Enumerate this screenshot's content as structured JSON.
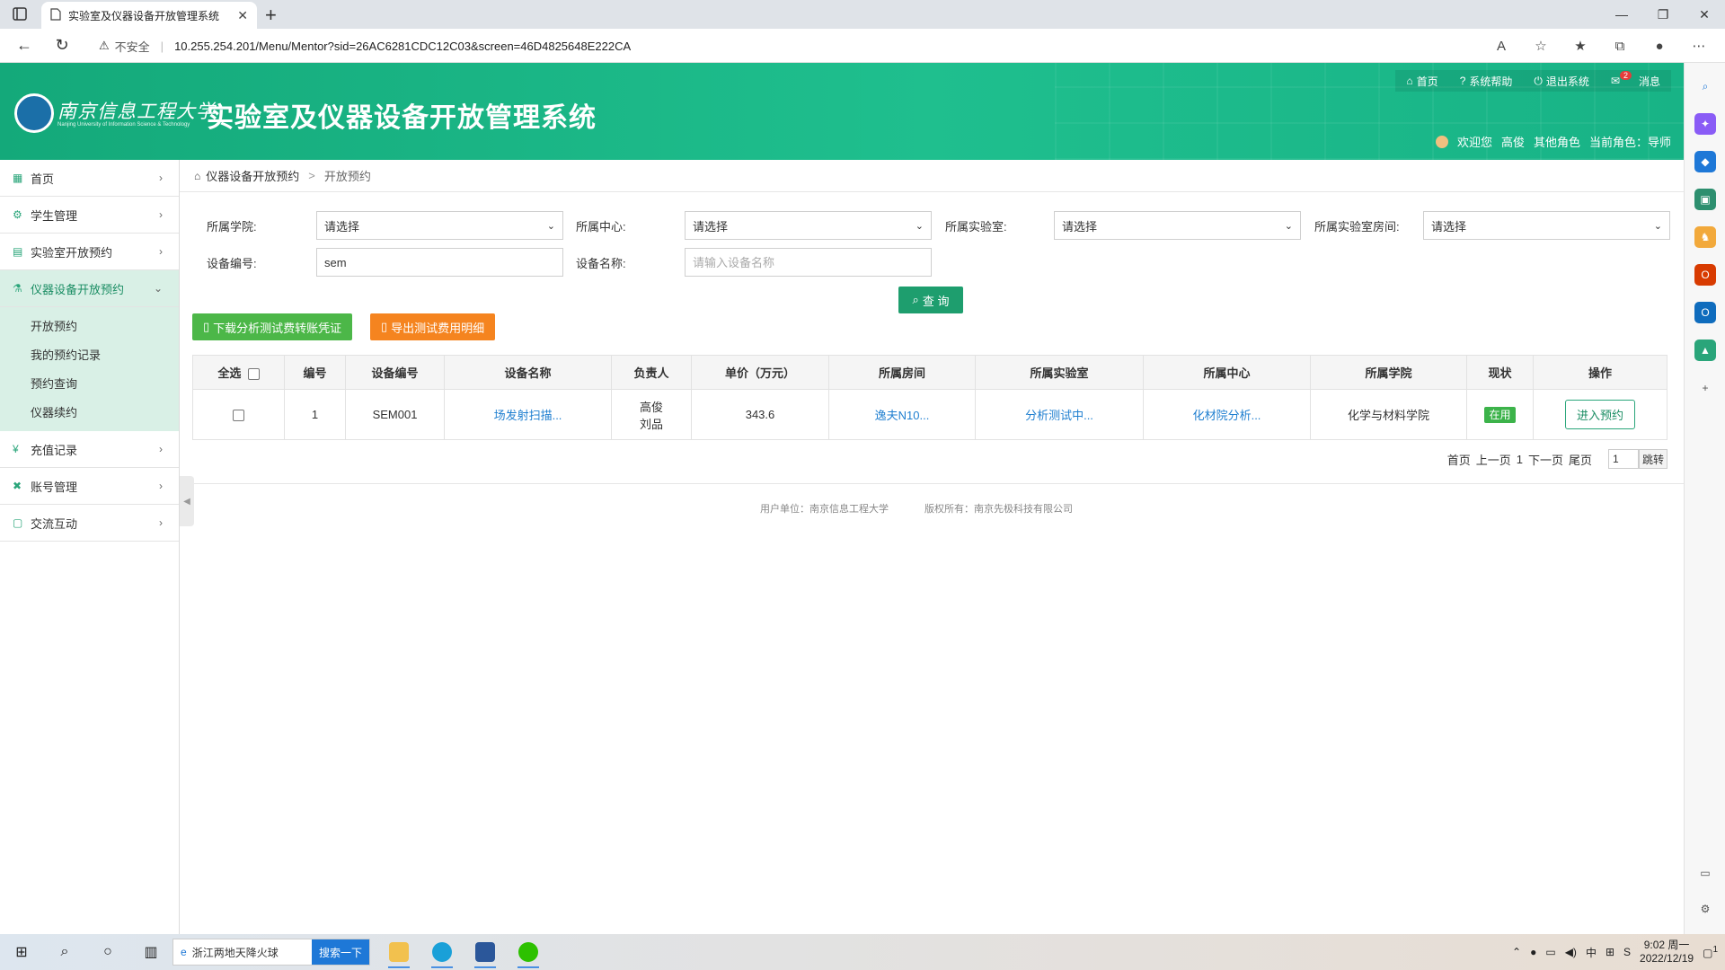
{
  "browser": {
    "tab_title": "实验室及仪器设备开放管理系统",
    "tab_close": "✕",
    "new_tab": "+",
    "insecure_label": "不安全",
    "url": "10.255.254.201/Menu/Mentor?sid=26AC6281CDC12C03&screen=46D4825648E222CA"
  },
  "header": {
    "university_name": "南京信息工程大学",
    "university_name_en": "Nanjing University of Information Science & Technology",
    "system_title": "实验室及仪器设备开放管理系统",
    "top_links": {
      "home": "首页",
      "help": "系统帮助",
      "logout": "退出系统",
      "messages": "消息",
      "messages_badge": "2"
    },
    "user": {
      "welcome": "欢迎您",
      "name": "高俊",
      "other_role": "其他角色",
      "current_role": "当前角色：导师"
    }
  },
  "sidebar": {
    "items": [
      {
        "label": "首页",
        "icon": "table-icon"
      },
      {
        "label": "学生管理",
        "icon": "gear-icon"
      },
      {
        "label": "实验室开放预约",
        "icon": "doc-icon"
      },
      {
        "label": "仪器设备开放预约",
        "icon": "flask-icon"
      },
      {
        "label": "充值记录",
        "icon": "coin-icon"
      },
      {
        "label": "账号管理",
        "icon": "tools-icon"
      },
      {
        "label": "交流互动",
        "icon": "chat-icon"
      }
    ],
    "sub_items": [
      "开放预约",
      "我的预约记录",
      "预约查询",
      "仪器续约"
    ]
  },
  "breadcrumb": {
    "parent": "仪器设备开放预约",
    "separator": ">",
    "current": "开放预约"
  },
  "filters": {
    "college_label": "所属学院:",
    "college_value": "请选择",
    "center_label": "所属中心:",
    "center_value": "请选择",
    "lab_label": "所属实验室:",
    "lab_value": "请选择",
    "room_label": "所属实验室房间:",
    "room_value": "请选择",
    "device_no_label": "设备编号:",
    "device_no_value": "sem",
    "device_name_label": "设备名称:",
    "device_name_placeholder": "请输入设备名称"
  },
  "actions": {
    "query": "查 询",
    "download": "下载分析测试费转账凭证",
    "export": "导出测试费用明细"
  },
  "table": {
    "headers": {
      "select_all": "全选",
      "no": "编号",
      "device_no": "设备编号",
      "device_name": "设备名称",
      "owner": "负责人",
      "price": "单价（万元）",
      "room": "所属房间",
      "lab": "所属实验室",
      "center": "所属中心",
      "college": "所属学院",
      "status": "现状",
      "op": "操作"
    },
    "rows": [
      {
        "no": "1",
        "device_no": "SEM001",
        "device_name": "场发射扫描...",
        "owner_1": "高俊",
        "owner_2": "刘品",
        "price": "343.6",
        "room": "逸夫N10...",
        "lab": "分析测试中...",
        "center": "化材院分析...",
        "college": "化学与材料学院",
        "status": "在用",
        "op": "进入预约"
      }
    ]
  },
  "pager": {
    "first": "首页",
    "prev": "上一页",
    "page": "1",
    "next": "下一页",
    "last": "尾页",
    "input": "1",
    "go": "跳转"
  },
  "footer": {
    "owner": "用户单位：南京信息工程大学",
    "copyright": "版权所有：南京先极科技有限公司"
  },
  "taskbar": {
    "search_text": "浙江两地天降火球",
    "search_button": "搜索一下",
    "time": "9:02 周一",
    "date": "2022/12/19",
    "notif_count": "1"
  },
  "colors": {
    "header_green": "#1fbf8e",
    "query_btn": "#1e9e6e",
    "download_btn": "#4cb748",
    "export_btn": "#f5841f",
    "link_blue": "#1f7fd0"
  }
}
